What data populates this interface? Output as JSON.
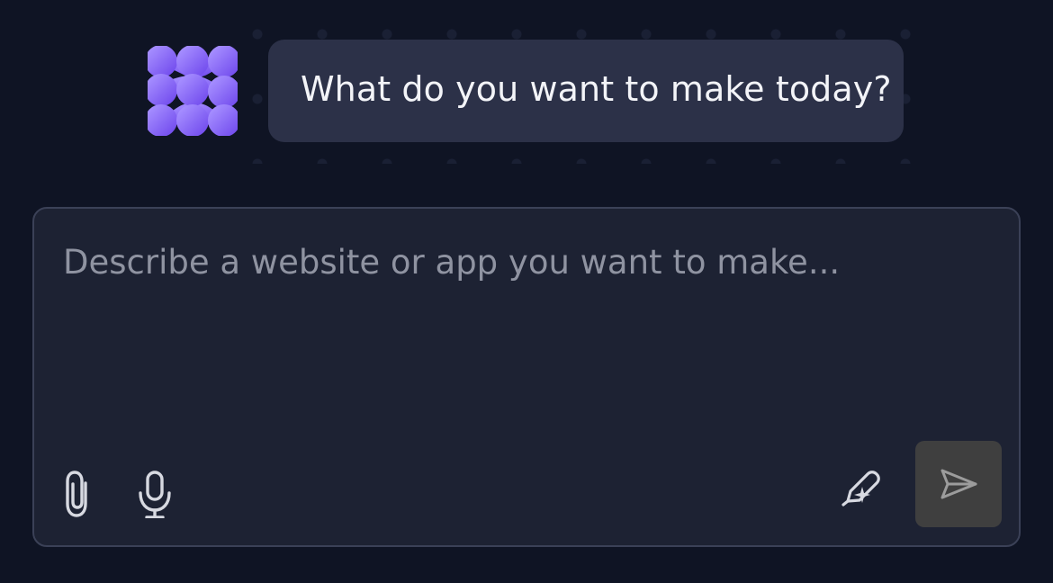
{
  "assistant": {
    "logo_icon": "brand-dots-logo",
    "greeting": "What do you want to make today?"
  },
  "composer": {
    "placeholder": "Describe a website or app you want to make...",
    "value": "",
    "left_actions": [
      {
        "icon": "paperclip-icon",
        "action": "attach"
      },
      {
        "icon": "microphone-icon",
        "action": "voice"
      }
    ],
    "right_actions": [
      {
        "icon": "pen-sparkle-icon",
        "action": "enhance"
      },
      {
        "icon": "send-icon",
        "action": "send",
        "state": "disabled"
      }
    ]
  },
  "colors": {
    "background": "#0f1424",
    "bubble": "#2c3148",
    "composer": "#1d2233",
    "border": "#3b4157",
    "brand_purple": "#8b67ff",
    "muted_text": "#8f93a1",
    "send_button": "#3f3f3f"
  }
}
